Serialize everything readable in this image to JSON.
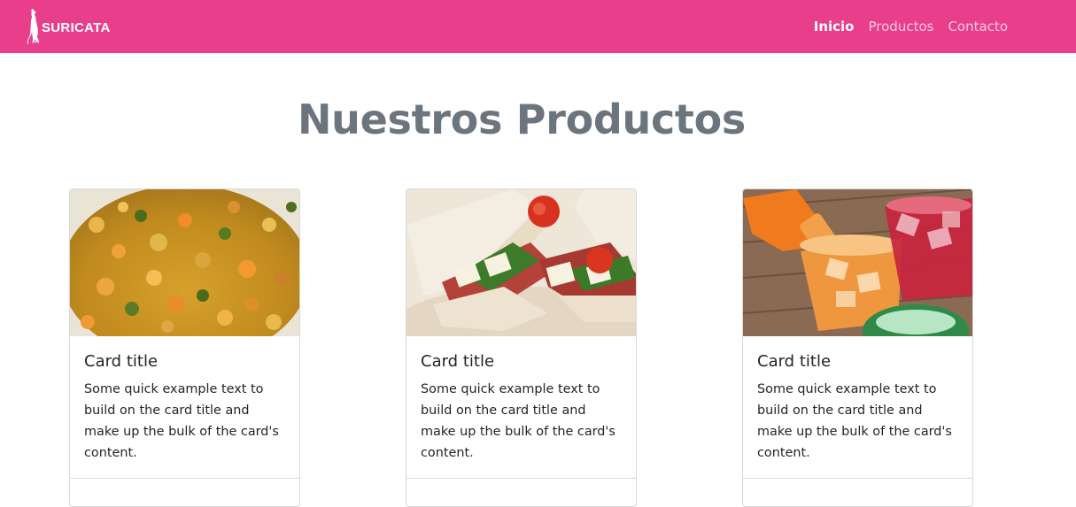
{
  "navbar": {
    "brand": {
      "logo_icon": "meerkat-logo-icon",
      "text": "SURICATA"
    },
    "links": [
      {
        "label": "Inicio",
        "active": true
      },
      {
        "label": "Productos",
        "active": false
      },
      {
        "label": "Contacto",
        "active": false
      }
    ],
    "background_color": "#e83e8c"
  },
  "main": {
    "title": "Nuestros Productos",
    "cards": [
      {
        "image": "food-stew-image",
        "title": "Card title",
        "text": "Some quick example text to build on the card title and make up the bulk of the card's content."
      },
      {
        "image": "sandwich-image",
        "title": "Card title",
        "text": "Some quick example text to build on the card title and make up the bulk of the card's content."
      },
      {
        "image": "drinks-image",
        "title": "Card title",
        "text": "Some quick example text to build on the card title and make up the bulk of the card's content."
      }
    ]
  }
}
